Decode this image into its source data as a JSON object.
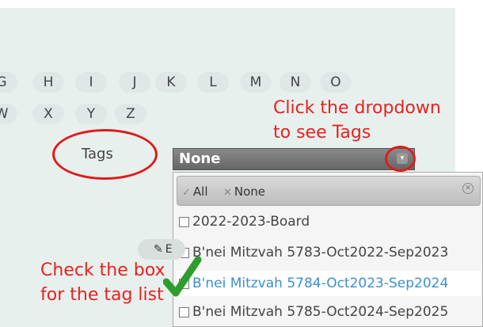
{
  "alphabet": {
    "row1": [
      "G",
      "H",
      "I",
      "J",
      "K",
      "L",
      "M",
      "N",
      "O"
    ],
    "row2": [
      "W",
      "X",
      "Y",
      "Z"
    ]
  },
  "tags_label": "Tags",
  "annotations": {
    "dropdown_hint_line1": "Click the dropdown",
    "dropdown_hint_line2": "to see Tags",
    "checkbox_hint_line1": "Check the box",
    "checkbox_hint_line2": "for the tag list"
  },
  "tag_select": {
    "value": "None"
  },
  "dropdown": {
    "all_label": "All",
    "none_label": "None",
    "options": [
      {
        "label": "2022-2023-Board",
        "highlighted": false
      },
      {
        "label": "B'nei Mitzvah 5783-Oct2022-Sep2023",
        "highlighted": false
      },
      {
        "label": "B'nei Mitzvah 5784-Oct2023-Sep2024",
        "highlighted": true
      },
      {
        "label": "B'nei Mitzvah 5785-Oct2024-Sep2025",
        "highlighted": false
      }
    ]
  },
  "edit_button": {
    "label": "E"
  },
  "colors": {
    "annotation_red": "#e8221f",
    "checkmark_green": "#2e9d2e",
    "highlight_text": "#3a8fd1"
  },
  "icons": {
    "check_all": "check-icon",
    "clear_none": "x-icon",
    "close_dropdown": "close-circle-icon",
    "select_arrow": "chevron-down-icon",
    "edit": "pencil-icon",
    "annotation_check": "green-checkmark-icon"
  }
}
